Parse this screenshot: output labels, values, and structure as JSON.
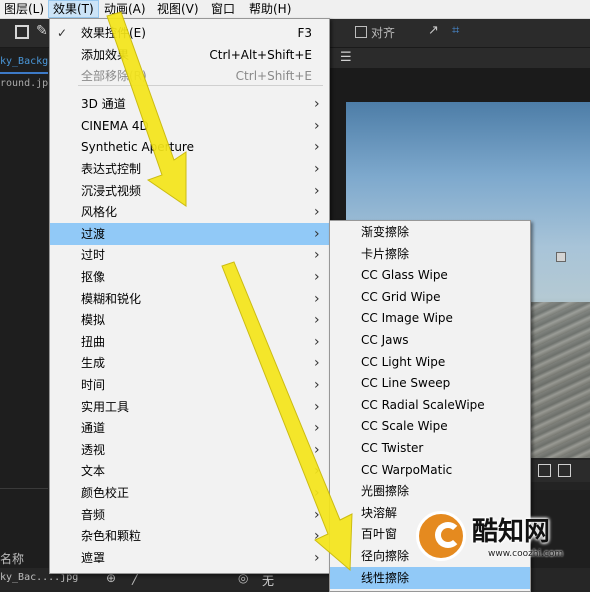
{
  "menubar": {
    "items": [
      "图层(L)",
      "效果(T)",
      "动画(A)",
      "视图(V)",
      "窗口",
      "帮助(H)"
    ]
  },
  "toolbar": {
    "snap_label": "对齐"
  },
  "project": {
    "tab_label": "ky_Backgr",
    "file_label": "round.jp",
    "column_header": "名称",
    "row_name": "ky_Bac....jpg"
  },
  "bottom_strip": {
    "none_label": "无"
  },
  "effects_menu": {
    "items": [
      {
        "label": "效果控件(E)",
        "shortcut": "F3",
        "checked": true
      },
      {
        "label": "添加效果",
        "shortcut": "Ctrl+Alt+Shift+E"
      },
      {
        "label": "全部移除(R)",
        "shortcut": "Ctrl+Shift+E",
        "disabled": true
      },
      {
        "label": "3D 通道",
        "submenu": true
      },
      {
        "label": "CINEMA 4D",
        "submenu": true
      },
      {
        "label": "Synthetic Aperture",
        "submenu": true
      },
      {
        "label": "表达式控制",
        "submenu": true
      },
      {
        "label": "沉浸式视频",
        "submenu": true
      },
      {
        "label": "风格化",
        "submenu": true
      },
      {
        "label": "过渡",
        "submenu": true,
        "highlighted": true
      },
      {
        "label": "过时",
        "submenu": true
      },
      {
        "label": "抠像",
        "submenu": true
      },
      {
        "label": "模糊和锐化",
        "submenu": true
      },
      {
        "label": "模拟",
        "submenu": true
      },
      {
        "label": "扭曲",
        "submenu": true
      },
      {
        "label": "生成",
        "submenu": true
      },
      {
        "label": "时间",
        "submenu": true
      },
      {
        "label": "实用工具",
        "submenu": true
      },
      {
        "label": "通道",
        "submenu": true
      },
      {
        "label": "透视",
        "submenu": true
      },
      {
        "label": "文本",
        "submenu": true
      },
      {
        "label": "颜色校正",
        "submenu": true
      },
      {
        "label": "音频",
        "submenu": true
      },
      {
        "label": "杂色和颗粒",
        "submenu": true
      },
      {
        "label": "遮罩",
        "submenu": true
      }
    ]
  },
  "transition_submenu": {
    "items": [
      {
        "label": "渐变擦除"
      },
      {
        "label": "卡片擦除"
      },
      {
        "label": "CC Glass Wipe"
      },
      {
        "label": "CC Grid Wipe"
      },
      {
        "label": "CC Image Wipe"
      },
      {
        "label": "CC Jaws"
      },
      {
        "label": "CC Light Wipe"
      },
      {
        "label": "CC Line Sweep"
      },
      {
        "label": "CC Radial ScaleWipe"
      },
      {
        "label": "CC Scale Wipe"
      },
      {
        "label": "CC Twister"
      },
      {
        "label": "CC WarpoMatic"
      },
      {
        "label": "光圈擦除"
      },
      {
        "label": "块溶解"
      },
      {
        "label": "百叶窗"
      },
      {
        "label": "径向擦除"
      },
      {
        "label": "线性擦除",
        "highlighted": true
      }
    ]
  },
  "watermark": {
    "title": "酷知网",
    "url": "www.coozhi.com"
  },
  "colors": {
    "arrow_yellow": "#f5e61a",
    "highlight_blue": "#91c9f7",
    "menu_bg": "#f2f2f2"
  }
}
